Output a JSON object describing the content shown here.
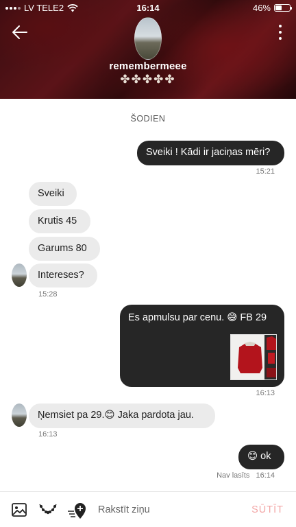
{
  "status_bar": {
    "carrier": "LV TELE2",
    "time": "16:14",
    "battery_percent": "46%",
    "battery_level": 0.46
  },
  "header": {
    "username": "remembermeee",
    "rating_stars": "✤✤✤✤✤",
    "back_icon": "back-arrow-icon",
    "menu_icon": "more-vertical-icon"
  },
  "conversation": {
    "day_label": "ŠODIEN",
    "messages": [
      {
        "text": "Sveiki ! Kādi ir jaciņas mēri?",
        "time": "15:21"
      },
      {
        "text": "Sveiki"
      },
      {
        "text": "Krutis 45"
      },
      {
        "text": "Garums 80"
      },
      {
        "text": "Intereses?",
        "time": "15:28"
      },
      {
        "text": "Es apmulsu par cenu. 😅  FB 29",
        "time": "16:13"
      },
      {
        "text": "Ņemsiet pa 29.😊  Jaka pardota jau.",
        "time": "16:13"
      },
      {
        "text": "😊  ok",
        "time": "16:14",
        "status": "Nav lasīts"
      }
    ]
  },
  "composer": {
    "placeholder": "Rakstīt ziņu",
    "send_label": "SŪTĪT",
    "icons": [
      "image-icon",
      "necklace-icon",
      "location-pin-icon"
    ]
  },
  "colors": {
    "outgoing_bubble": "#262626",
    "incoming_bubble": "#ebebeb",
    "send_disabled": "#f3a6a6"
  }
}
